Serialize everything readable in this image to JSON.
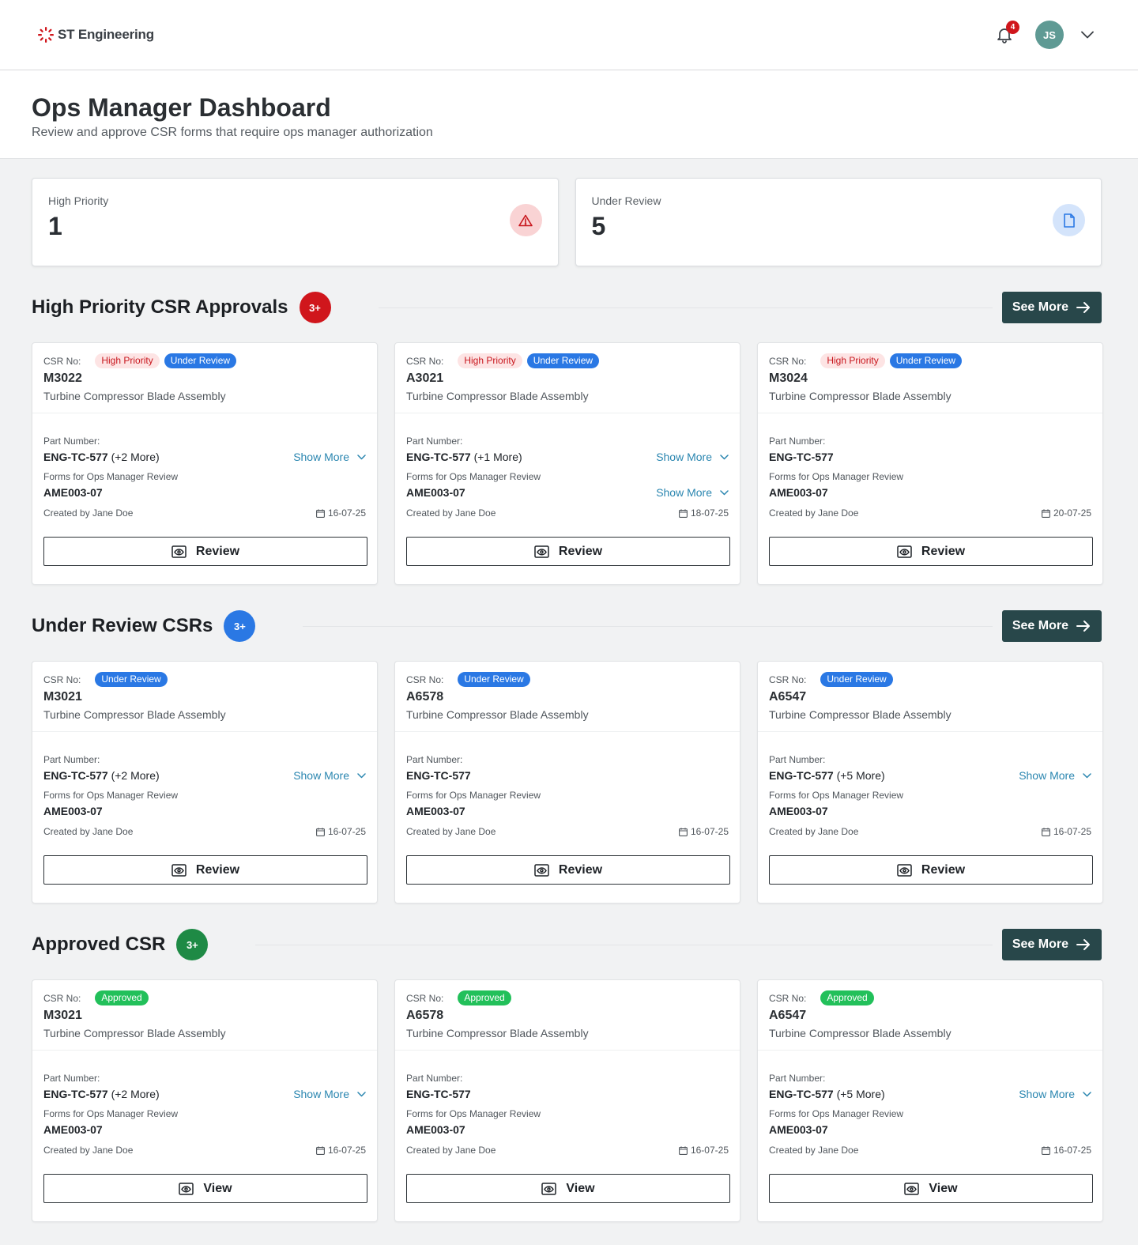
{
  "brand": {
    "name": "ST Engineering",
    "accent": "#d0161c"
  },
  "nav": {
    "notification_count": "4",
    "user_initials": "JS"
  },
  "header": {
    "title": "Ops Manager Dashboard",
    "subtitle": "Review and approve CSR forms that require ops manager authorization"
  },
  "stats": [
    {
      "label": "High Priority",
      "value": "1",
      "icon": "warning-triangle-icon"
    },
    {
      "label": "Under Review",
      "value": "5",
      "icon": "document-icon"
    }
  ],
  "labels": {
    "csr_no": "CSR No:",
    "part_number": "Part Number:",
    "forms": "Forms for Ops Manager Review",
    "show_more": "Show More",
    "see_more": "See More"
  },
  "sections": [
    {
      "title": "High Priority CSR Approvals",
      "count": "3+",
      "badge_color": "#d0161c",
      "action": "Review",
      "cards": [
        {
          "tags": [
            "High Priority",
            "Under Review"
          ],
          "csr": "M3022",
          "desc": "Turbine Compressor Blade Assembly",
          "part": "ENG-TC-577",
          "part_more": "(+2 More)",
          "form": "AME003-07",
          "form_more": false,
          "created": "Created by Jane Doe",
          "date": "16-07-25"
        },
        {
          "tags": [
            "High Priority",
            "Under Review"
          ],
          "csr": "A3021",
          "desc": "Turbine Compressor Blade Assembly",
          "part": "ENG-TC-577",
          "part_more": "(+1 More)",
          "form": "AME003-07",
          "form_more": true,
          "created": "Created by Jane Doe",
          "date": "18-07-25"
        },
        {
          "tags": [
            "High Priority",
            "Under Review"
          ],
          "csr": "M3024",
          "desc": "Turbine Compressor Blade Assembly",
          "part": "ENG-TC-577",
          "part_more": "",
          "form": "AME003-07",
          "form_more": false,
          "created": "Created by Jane Doe",
          "date": "20-07-25"
        }
      ]
    },
    {
      "title": "Under Review CSRs",
      "count": "3+",
      "badge_color": "#2a78e4",
      "action": "Review",
      "cards": [
        {
          "tags": [
            "Under Review"
          ],
          "csr": "M3021",
          "desc": "Turbine Compressor Blade Assembly",
          "part": "ENG-TC-577",
          "part_more": "(+2 More)",
          "form": "AME003-07",
          "form_more": false,
          "created": "Created by Jane Doe",
          "date": "16-07-25"
        },
        {
          "tags": [
            "Under Review"
          ],
          "csr": "A6578",
          "desc": "Turbine Compressor Blade Assembly",
          "part": "ENG-TC-577",
          "part_more": "",
          "form": "AME003-07",
          "form_more": false,
          "created": "Created by Jane Doe",
          "date": "16-07-25"
        },
        {
          "tags": [
            "Under Review"
          ],
          "csr": "A6547",
          "desc": "Turbine Compressor Blade Assembly",
          "part": "ENG-TC-577",
          "part_more": "(+5 More)",
          "form": "AME003-07",
          "form_more": false,
          "created": "Created by Jane Doe",
          "date": "16-07-25"
        }
      ]
    },
    {
      "title": "Approved CSR",
      "count": "3+",
      "badge_color": "#1e8a45",
      "action": "View",
      "cards": [
        {
          "tags": [
            "Approved"
          ],
          "csr": "M3021",
          "desc": "Turbine Compressor Blade Assembly",
          "part": "ENG-TC-577",
          "part_more": "(+2 More)",
          "form": "AME003-07",
          "form_more": false,
          "created": "Created by Jane Doe",
          "date": "16-07-25"
        },
        {
          "tags": [
            "Approved"
          ],
          "csr": "A6578",
          "desc": "Turbine Compressor Blade Assembly",
          "part": "ENG-TC-577",
          "part_more": "",
          "form": "AME003-07",
          "form_more": false,
          "created": "Created by Jane Doe",
          "date": "16-07-25"
        },
        {
          "tags": [
            "Approved"
          ],
          "csr": "A6547",
          "desc": "Turbine Compressor Blade Assembly",
          "part": "ENG-TC-577",
          "part_more": "(+5 More)",
          "form": "AME003-07",
          "form_more": false,
          "created": "Created by Jane Doe",
          "date": "16-07-25"
        }
      ]
    }
  ]
}
